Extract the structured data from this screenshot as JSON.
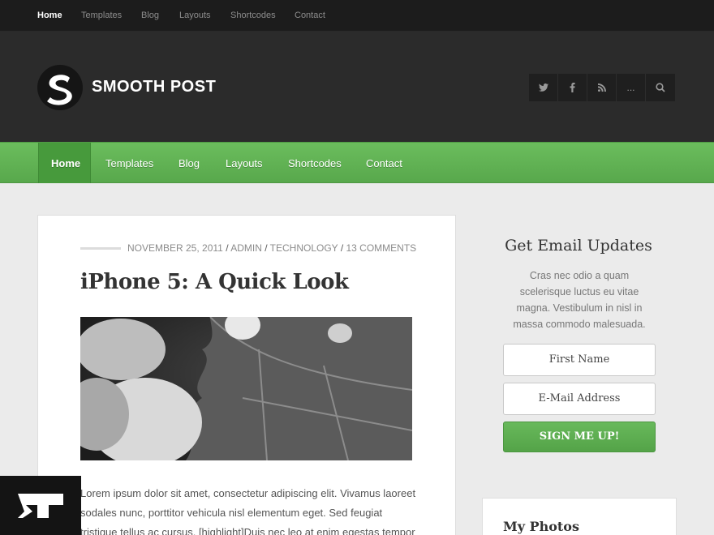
{
  "topnav": [
    "Home",
    "Templates",
    "Blog",
    "Layouts",
    "Shortcodes",
    "Contact"
  ],
  "brand": {
    "name": "SMOOTH POST"
  },
  "social": {
    "twitter": "twitter-icon",
    "facebook": "facebook-icon",
    "rss": "rss-icon",
    "more": "...",
    "search": "search-icon"
  },
  "mainnav": [
    "Home",
    "Templates",
    "Blog",
    "Layouts",
    "Shortcodes",
    "Contact"
  ],
  "post": {
    "date": "NOVEMBER 25, 2011",
    "author": "ADMIN",
    "category": "TECHNOLOGY",
    "comments": "13 COMMENTS",
    "title": "iPhone 5: A Quick Look",
    "excerpt": "Lorem ipsum dolor sit amet, consectetur adipiscing elit. Vivamus laoreet sodales nunc, porttitor vehicula nisl elementum eget. Sed feugiat tristique tellus ac cursus. [highlight]Duis nec leo at enim egestas tempor"
  },
  "sidebar": {
    "email_title": "Get Email Updates",
    "email_text": "Cras nec odio a quam scelerisque luctus eu vitae magna. Vestibulum in nisl in massa commodo malesuada.",
    "first_name": "First Name",
    "email": "E-Mail Address",
    "signup": "SIGN ME UP!",
    "photos_title": "My Photos"
  },
  "colors": {
    "accent": "#5fb252",
    "dark": "#2b2b2b"
  }
}
